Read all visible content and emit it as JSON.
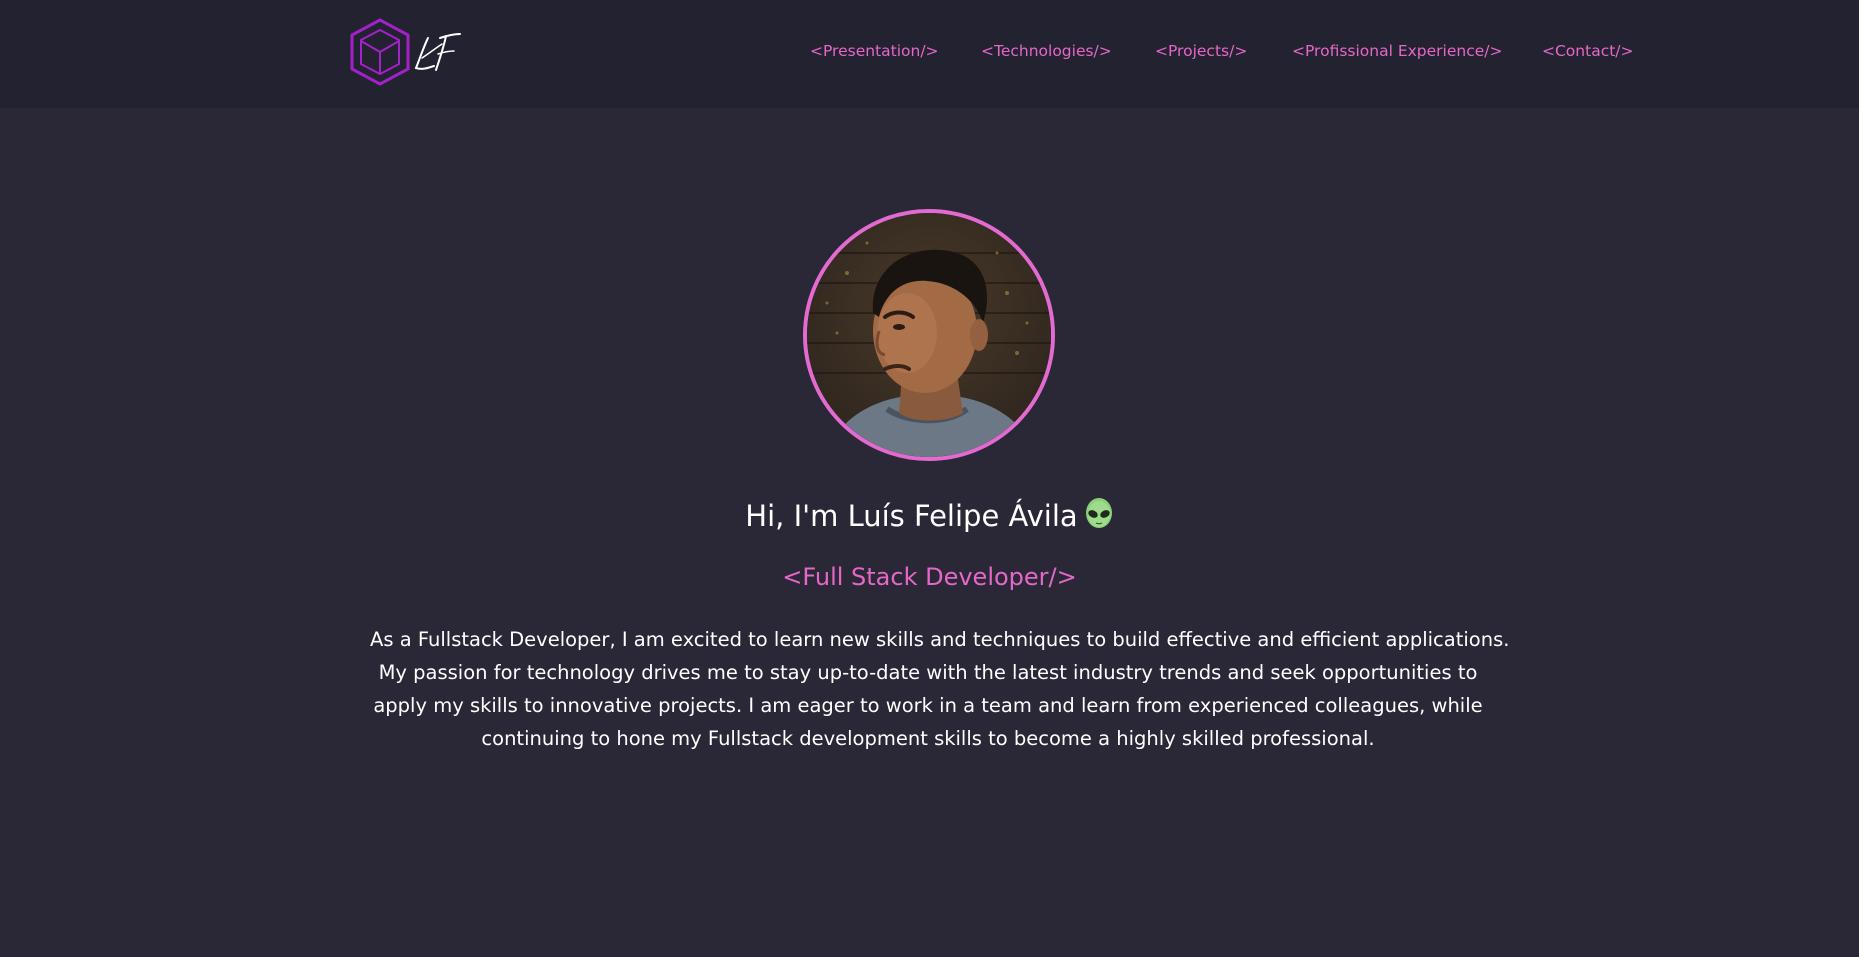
{
  "logo": {
    "icon": "hexagon-cube-icon",
    "monogram": "LF",
    "accent": "#a321c9"
  },
  "nav": {
    "items": [
      {
        "label": "<Presentation/>"
      },
      {
        "label": "<Technologies/>"
      },
      {
        "label": "<Projects/>"
      },
      {
        "label": "<Profissional Experience/>"
      },
      {
        "label": "<Contact/>"
      }
    ]
  },
  "hero": {
    "avatar_icon": "profile-photo",
    "greeting": "Hi, I'm Luís Felipe Ávila",
    "greeting_emoji": "alien-icon",
    "role": "<Full Stack Developer/>",
    "bio_lines": [
      "As a Fullstack Developer, I am excited to learn new skills and techniques to build effective and efficient applications.",
      "My passion for technology drives me to stay up-to-date with the latest industry trends and seek opportunities to",
      "apply my skills to innovative projects. I am eager to work in a team and learn from experienced colleagues, while",
      "continuing to hone my Fullstack development skills to become a highly skilled professional."
    ]
  },
  "colors": {
    "background": "#2a2837",
    "header": "#232230",
    "accent_pink": "#e567c7",
    "text": "#ffffff"
  }
}
